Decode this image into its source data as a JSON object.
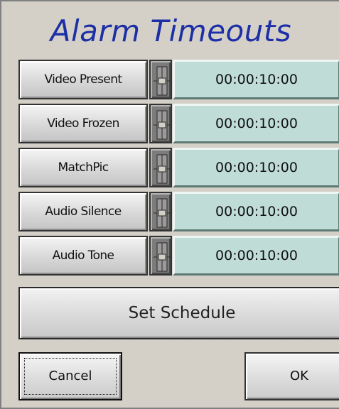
{
  "dialog": {
    "title": "Alarm Timeouts"
  },
  "alarms": [
    {
      "label": "Video Present",
      "value": "00:00:10:00"
    },
    {
      "label": "Video Frozen",
      "value": "00:00:10:00"
    },
    {
      "label": "MatchPic",
      "value": "00:00:10:00"
    },
    {
      "label": "Audio Silence",
      "value": "00:00:10:00"
    },
    {
      "label": "Audio Tone",
      "value": "00:00:10:00"
    }
  ],
  "buttons": {
    "schedule_label": "Set Schedule",
    "cancel_label": "Cancel",
    "ok_label": "OK"
  },
  "colors": {
    "title": "#1c2fa6",
    "value_field": "#bfdcd6",
    "background": "#d4d0c8"
  },
  "icons": {
    "spin": "slider-handle-icon"
  }
}
